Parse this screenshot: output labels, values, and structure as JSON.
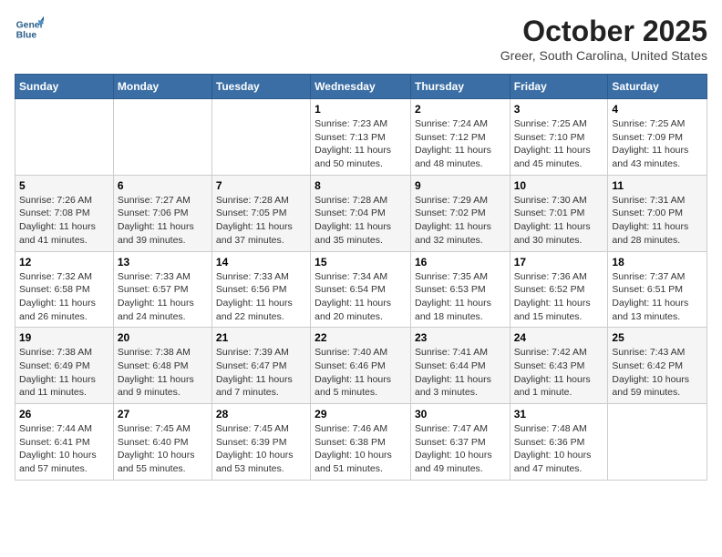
{
  "header": {
    "logo_line1": "General",
    "logo_line2": "Blue",
    "month": "October 2025",
    "location": "Greer, South Carolina, United States"
  },
  "weekdays": [
    "Sunday",
    "Monday",
    "Tuesday",
    "Wednesday",
    "Thursday",
    "Friday",
    "Saturday"
  ],
  "weeks": [
    [
      {
        "day": "",
        "info": ""
      },
      {
        "day": "",
        "info": ""
      },
      {
        "day": "",
        "info": ""
      },
      {
        "day": "1",
        "info": "Sunrise: 7:23 AM\nSunset: 7:13 PM\nDaylight: 11 hours\nand 50 minutes."
      },
      {
        "day": "2",
        "info": "Sunrise: 7:24 AM\nSunset: 7:12 PM\nDaylight: 11 hours\nand 48 minutes."
      },
      {
        "day": "3",
        "info": "Sunrise: 7:25 AM\nSunset: 7:10 PM\nDaylight: 11 hours\nand 45 minutes."
      },
      {
        "day": "4",
        "info": "Sunrise: 7:25 AM\nSunset: 7:09 PM\nDaylight: 11 hours\nand 43 minutes."
      }
    ],
    [
      {
        "day": "5",
        "info": "Sunrise: 7:26 AM\nSunset: 7:08 PM\nDaylight: 11 hours\nand 41 minutes."
      },
      {
        "day": "6",
        "info": "Sunrise: 7:27 AM\nSunset: 7:06 PM\nDaylight: 11 hours\nand 39 minutes."
      },
      {
        "day": "7",
        "info": "Sunrise: 7:28 AM\nSunset: 7:05 PM\nDaylight: 11 hours\nand 37 minutes."
      },
      {
        "day": "8",
        "info": "Sunrise: 7:28 AM\nSunset: 7:04 PM\nDaylight: 11 hours\nand 35 minutes."
      },
      {
        "day": "9",
        "info": "Sunrise: 7:29 AM\nSunset: 7:02 PM\nDaylight: 11 hours\nand 32 minutes."
      },
      {
        "day": "10",
        "info": "Sunrise: 7:30 AM\nSunset: 7:01 PM\nDaylight: 11 hours\nand 30 minutes."
      },
      {
        "day": "11",
        "info": "Sunrise: 7:31 AM\nSunset: 7:00 PM\nDaylight: 11 hours\nand 28 minutes."
      }
    ],
    [
      {
        "day": "12",
        "info": "Sunrise: 7:32 AM\nSunset: 6:58 PM\nDaylight: 11 hours\nand 26 minutes."
      },
      {
        "day": "13",
        "info": "Sunrise: 7:33 AM\nSunset: 6:57 PM\nDaylight: 11 hours\nand 24 minutes."
      },
      {
        "day": "14",
        "info": "Sunrise: 7:33 AM\nSunset: 6:56 PM\nDaylight: 11 hours\nand 22 minutes."
      },
      {
        "day": "15",
        "info": "Sunrise: 7:34 AM\nSunset: 6:54 PM\nDaylight: 11 hours\nand 20 minutes."
      },
      {
        "day": "16",
        "info": "Sunrise: 7:35 AM\nSunset: 6:53 PM\nDaylight: 11 hours\nand 18 minutes."
      },
      {
        "day": "17",
        "info": "Sunrise: 7:36 AM\nSunset: 6:52 PM\nDaylight: 11 hours\nand 15 minutes."
      },
      {
        "day": "18",
        "info": "Sunrise: 7:37 AM\nSunset: 6:51 PM\nDaylight: 11 hours\nand 13 minutes."
      }
    ],
    [
      {
        "day": "19",
        "info": "Sunrise: 7:38 AM\nSunset: 6:49 PM\nDaylight: 11 hours\nand 11 minutes."
      },
      {
        "day": "20",
        "info": "Sunrise: 7:38 AM\nSunset: 6:48 PM\nDaylight: 11 hours\nand 9 minutes."
      },
      {
        "day": "21",
        "info": "Sunrise: 7:39 AM\nSunset: 6:47 PM\nDaylight: 11 hours\nand 7 minutes."
      },
      {
        "day": "22",
        "info": "Sunrise: 7:40 AM\nSunset: 6:46 PM\nDaylight: 11 hours\nand 5 minutes."
      },
      {
        "day": "23",
        "info": "Sunrise: 7:41 AM\nSunset: 6:44 PM\nDaylight: 11 hours\nand 3 minutes."
      },
      {
        "day": "24",
        "info": "Sunrise: 7:42 AM\nSunset: 6:43 PM\nDaylight: 11 hours\nand 1 minute."
      },
      {
        "day": "25",
        "info": "Sunrise: 7:43 AM\nSunset: 6:42 PM\nDaylight: 10 hours\nand 59 minutes."
      }
    ],
    [
      {
        "day": "26",
        "info": "Sunrise: 7:44 AM\nSunset: 6:41 PM\nDaylight: 10 hours\nand 57 minutes."
      },
      {
        "day": "27",
        "info": "Sunrise: 7:45 AM\nSunset: 6:40 PM\nDaylight: 10 hours\nand 55 minutes."
      },
      {
        "day": "28",
        "info": "Sunrise: 7:45 AM\nSunset: 6:39 PM\nDaylight: 10 hours\nand 53 minutes."
      },
      {
        "day": "29",
        "info": "Sunrise: 7:46 AM\nSunset: 6:38 PM\nDaylight: 10 hours\nand 51 minutes."
      },
      {
        "day": "30",
        "info": "Sunrise: 7:47 AM\nSunset: 6:37 PM\nDaylight: 10 hours\nand 49 minutes."
      },
      {
        "day": "31",
        "info": "Sunrise: 7:48 AM\nSunset: 6:36 PM\nDaylight: 10 hours\nand 47 minutes."
      },
      {
        "day": "",
        "info": ""
      }
    ]
  ]
}
